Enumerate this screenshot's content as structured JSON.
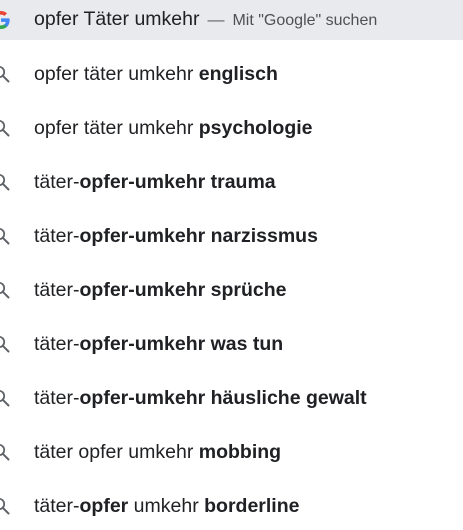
{
  "google_row": {
    "query": "opfer Täter umkehr",
    "separator": "—",
    "hint": "Mit \"Google\" suchen",
    "icon": "google-g-icon"
  },
  "suggestions": [
    {
      "normal": "opfer täter umkehr ",
      "bold": "englisch"
    },
    {
      "normal": "opfer täter umkehr ",
      "bold": "psychologie"
    },
    {
      "prefix": "täter-",
      "bold": "opfer-umkehr trauma"
    },
    {
      "prefix": "täter-",
      "bold": "opfer-umkehr narzissmus"
    },
    {
      "prefix": "täter-",
      "bold": "opfer-umkehr sprüche"
    },
    {
      "prefix": "täter-",
      "bold": "opfer-umkehr was tun"
    },
    {
      "prefix": "täter-",
      "bold": "opfer-umkehr häusliche gewalt"
    },
    {
      "normal": "täter opfer umkehr ",
      "bold": "mobbing"
    },
    {
      "prefix": "täter-",
      "bold_mid": "opfer",
      "mid": " umkehr ",
      "bold": "borderline"
    }
  ],
  "suggestion_icon": "search-icon",
  "colors": {
    "highlight_bg": "#e8eaed",
    "text": "#202124",
    "google_blue": "#4285F4",
    "google_red": "#EA4335",
    "google_yellow": "#FBBC05",
    "google_green": "#34A853"
  }
}
